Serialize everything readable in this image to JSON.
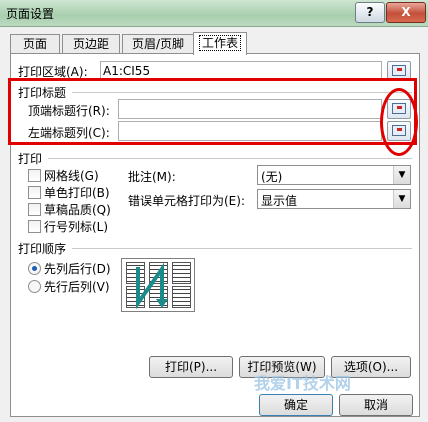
{
  "window": {
    "title": "页面设置",
    "help_glyph": "?",
    "close_glyph": "X"
  },
  "tabs": [
    {
      "label": "页面"
    },
    {
      "label": "页边距"
    },
    {
      "label": "页眉/页脚"
    },
    {
      "label": "工作表",
      "active": true
    }
  ],
  "print_area": {
    "label": "打印区域(A):",
    "value": "A1:CI55"
  },
  "print_titles": {
    "heading": "打印标题",
    "rows_label": "顶端标题行(R):",
    "rows_value": "",
    "cols_label": "左端标题列(C):",
    "cols_value": ""
  },
  "print": {
    "heading": "打印",
    "options": [
      {
        "label": "网格线(G)",
        "checked": false
      },
      {
        "label": "单色打印(B)",
        "checked": false
      },
      {
        "label": "草稿品质(Q)",
        "checked": false
      },
      {
        "label": "行号列标(L)",
        "checked": false
      }
    ],
    "comments_label": "批注(M):",
    "comments_value": "(无)",
    "errors_label": "错误单元格打印为(E):",
    "errors_value": "显示值"
  },
  "page_order": {
    "heading": "打印顺序",
    "options": [
      {
        "label": "先列后行(D)",
        "selected": true
      },
      {
        "label": "先行后列(V)",
        "selected": false
      }
    ]
  },
  "buttons": {
    "print": "打印(P)...",
    "preview": "打印预览(W)",
    "options": "选项(O)...",
    "ok": "确定",
    "cancel": "取消"
  },
  "watermark": "我爱IT技术网",
  "colors": {
    "highlight": "#e00000",
    "accent": "#1d5fb4",
    "titlebar": "#a8cfae"
  }
}
